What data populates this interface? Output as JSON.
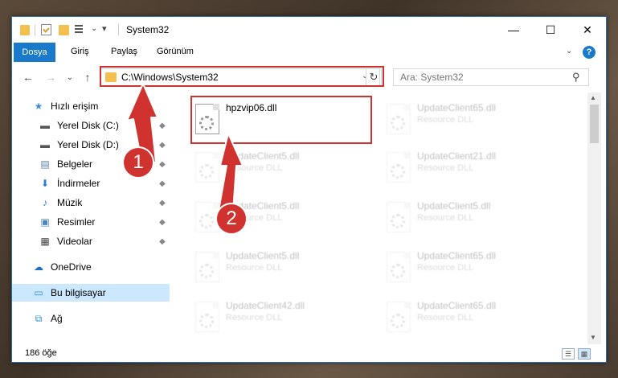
{
  "window": {
    "title": "System32",
    "minimize_glyph": "—",
    "maximize_glyph": "☐",
    "close_glyph": "✕"
  },
  "ribbon": {
    "tabs": [
      {
        "label": "Dosya"
      },
      {
        "label": "Giriş"
      },
      {
        "label": "Paylaş"
      },
      {
        "label": "Görünüm"
      }
    ],
    "expand_glyph": "⌄",
    "help_glyph": "?"
  },
  "navigation": {
    "back_glyph": "←",
    "forward_glyph": "→",
    "recent_glyph": "⌄",
    "up_glyph": "↑"
  },
  "address": {
    "path": "C:\\Windows\\System32",
    "dropdown_glyph": "⌄",
    "refresh_glyph": "↻"
  },
  "search": {
    "placeholder": "Ara: System32",
    "icon_glyph": "⚲"
  },
  "sidebar": {
    "items": [
      {
        "label": "Hızlı erişim",
        "icon": "star-icon",
        "glyph": "★",
        "color": "#3f8fdb"
      },
      {
        "label": "Yerel Disk (C:)",
        "icon": "drive-icon",
        "glyph": "▬",
        "color": "#555555"
      },
      {
        "label": "Yerel Disk (D:)",
        "icon": "drive-icon",
        "glyph": "▬",
        "color": "#555555"
      },
      {
        "label": "Belgeler",
        "icon": "documents-icon",
        "glyph": "▤",
        "color": "#5a7da8"
      },
      {
        "label": "İndirmeler",
        "icon": "download-icon",
        "glyph": "⬇",
        "color": "#2b7bd4"
      },
      {
        "label": "Müzik",
        "icon": "music-icon",
        "glyph": "♪",
        "color": "#2b7bd4"
      },
      {
        "label": "Resimler",
        "icon": "pictures-icon",
        "glyph": "▣",
        "color": "#4a86c5"
      },
      {
        "label": "Videolar",
        "icon": "video-icon",
        "glyph": "▦",
        "color": "#444444"
      },
      {
        "label": "OneDrive",
        "icon": "cloud-icon",
        "glyph": "☁",
        "color": "#1c6fc4"
      },
      {
        "label": "Bu bilgisayar",
        "icon": "computer-icon",
        "glyph": "▭",
        "color": "#2d8fd8"
      },
      {
        "label": "Ağ",
        "icon": "network-icon",
        "glyph": "⧉",
        "color": "#2d8fd8"
      }
    ],
    "pin_glyph": "📌"
  },
  "files": [
    {
      "name": "hpzvip06.dll",
      "type": ""
    },
    {
      "name": "UpdateClient65.dll",
      "type": "Resource DLL"
    },
    {
      "name": "UpdateClient5.dll",
      "type": "Resource DLL"
    },
    {
      "name": "UpdateClient21.dll",
      "type": "Resource DLL"
    },
    {
      "name": "UpdateClient5.dll",
      "type": "Resource DLL"
    },
    {
      "name": "UpdateClient5.dll",
      "type": "Resource DLL"
    },
    {
      "name": "UpdateClient5.dll",
      "type": "Resource DLL"
    },
    {
      "name": "UpdateClient65.dll",
      "type": "Resource DLL"
    },
    {
      "name": "UpdateClient42.dll",
      "type": "Resource DLL"
    },
    {
      "name": "UpdateClient65.dll",
      "type": "Resource DLL"
    }
  ],
  "status": {
    "item_count": "186 öğe"
  },
  "annotations": {
    "marker_1": "1",
    "marker_2": "2",
    "color": "#d0332f"
  }
}
